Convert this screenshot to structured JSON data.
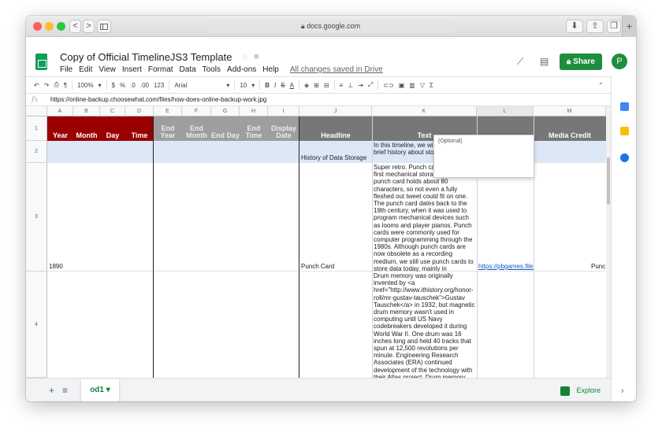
{
  "browser": {
    "url": "docs.google.com",
    "back": "<",
    "forward": ">",
    "new_tab": "+"
  },
  "app": {
    "title": "Copy of Official TimelineJS3 Template",
    "menu": [
      "File",
      "Edit",
      "View",
      "Insert",
      "Format",
      "Data",
      "Tools",
      "Add-ons",
      "Help"
    ],
    "saved_status": "All changes saved in Drive",
    "share_label": "Share",
    "avatar_initial": "P"
  },
  "toolbar": {
    "zoom": "100%",
    "currency": "$",
    "percent": "%",
    "dec_less": ".0",
    "dec_more": ".00",
    "format_more": "123",
    "font": "Arial",
    "font_size": "10",
    "bold": "B",
    "italic": "I",
    "strike": "S",
    "text_color": "A"
  },
  "formula_bar": {
    "fx": "fx",
    "value": "https://online-backup.choosewhat.com/files/how-does-online-backup-work.jpg"
  },
  "columns": [
    "A",
    "B",
    "C",
    "D",
    "E",
    "F",
    "G",
    "H",
    "I",
    "J",
    "K",
    "L",
    "M"
  ],
  "rows": [
    "1",
    "2",
    "3",
    "4"
  ],
  "headers": {
    "year": "Year",
    "month": "Month",
    "day": "Day",
    "time": "Time",
    "end_year": "End Year",
    "end_month": "End Month",
    "end_day": "End Day",
    "end_time": "End Time",
    "display_date": "Display Date",
    "headline": "Headline",
    "text": "Text",
    "media_credit": "Media Credit"
  },
  "comment": "(Optional)",
  "cells": {
    "r2_headline": "History of Data Storage",
    "r2_text": "In this timeline, we will the brief history about storage",
    "r3_year": "1890",
    "r3_headline": "Punch Card",
    "r3_text": "Super retro. Punch cards were the first mechanical storage method. A punch card holds about 80 characters, so not even a fully fleshed out tweet could fit on one. The punch card dates back to the 19th century, when it was used to program mechanical devices such as looms and player pianos. Punch cards were commonly used for computer programming through the 1980s. Although punch cards are now obsolete as a recording medium, we still use punch cards to store data today, mainly in standardized tests and voting.",
    "r3_media": "https://pbgames.files",
    "r3_media_credit": "Punc",
    "r4_text": "Drum memory was originally invented by <a href=\"http://www.ithistory.org/honor-roll/mr-gustav-tauschek\">Gustav Tauschek</a> in 1932, but magnetic drum memory wasn't used in computing until US Navy codebreakers developed it during World War II. One drum was 16 inches long and held 40 tracks that spun at 12,500 revolutions per minute. Engineering Research Associates (ERA) continued development of the technology with their Atlas project. Drum memory consisted of a long metal cylinder"
  },
  "sheet_tab": "od1",
  "explore_label": "Explore",
  "colors": {
    "header_red": "#990000",
    "header_gray": "#9e9e9e",
    "header_dark": "#777777",
    "accent_green": "#1e8e3e",
    "link_blue": "#1155cc"
  }
}
